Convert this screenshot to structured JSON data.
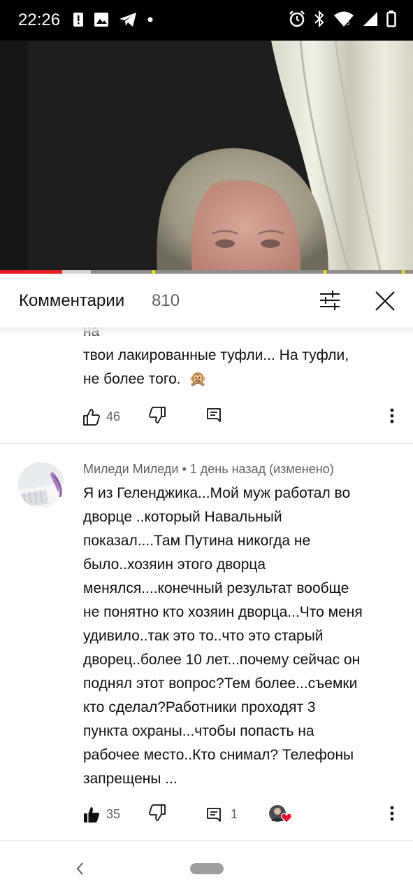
{
  "status_bar": {
    "time": "22:26",
    "left_icons": [
      "alert-icon",
      "image-icon",
      "telegram-icon",
      "dot-icon"
    ],
    "right_icons": [
      "alarm-icon",
      "bluetooth-icon",
      "wifi-icon",
      "signal-icon",
      "battery-icon"
    ]
  },
  "video": {
    "progress_played": 0.15,
    "progress_buffered": 0.22
  },
  "comments_panel": {
    "title": "Комментарии",
    "count": "810",
    "filter_icon": "sliders-icon",
    "close_icon": "close-icon"
  },
  "comments": [
    {
      "text_lines": [
        "на",
        "твои  лакированные  туфли...  На туфли,",
        "не более того."
      ],
      "emoji": "🙊",
      "likes": "46"
    },
    {
      "author": "Миледи Миледи",
      "meta": " • 1 день назад (изменено)",
      "text_lines": [
        "Я из Геленджика...Мой муж работал во",
        "дворце ..который Навальный",
        "показал....Там Путина никогда не",
        "было..хозяин этого дворца",
        "менялся....конечный результат вообще",
        "не понятно кто хозяин дворца...Что меня",
        "удивило..так это то..что это старый",
        "дворец..более 10 лет...почему сейчас он",
        "поднял этот вопрос?Тем более...съемки",
        "кто сделал?Работники проходят 3",
        "пункта охраны...чтобы попасть на",
        "рабочее место..Кто снимал? Телефоны",
        "запрещены ..."
      ],
      "likes": "35",
      "replies": "1"
    }
  ],
  "colors": {
    "accent_red": "#e52222",
    "heart_red": "#e8112d",
    "text_primary": "#0f0f0f",
    "text_secondary": "#606060"
  }
}
